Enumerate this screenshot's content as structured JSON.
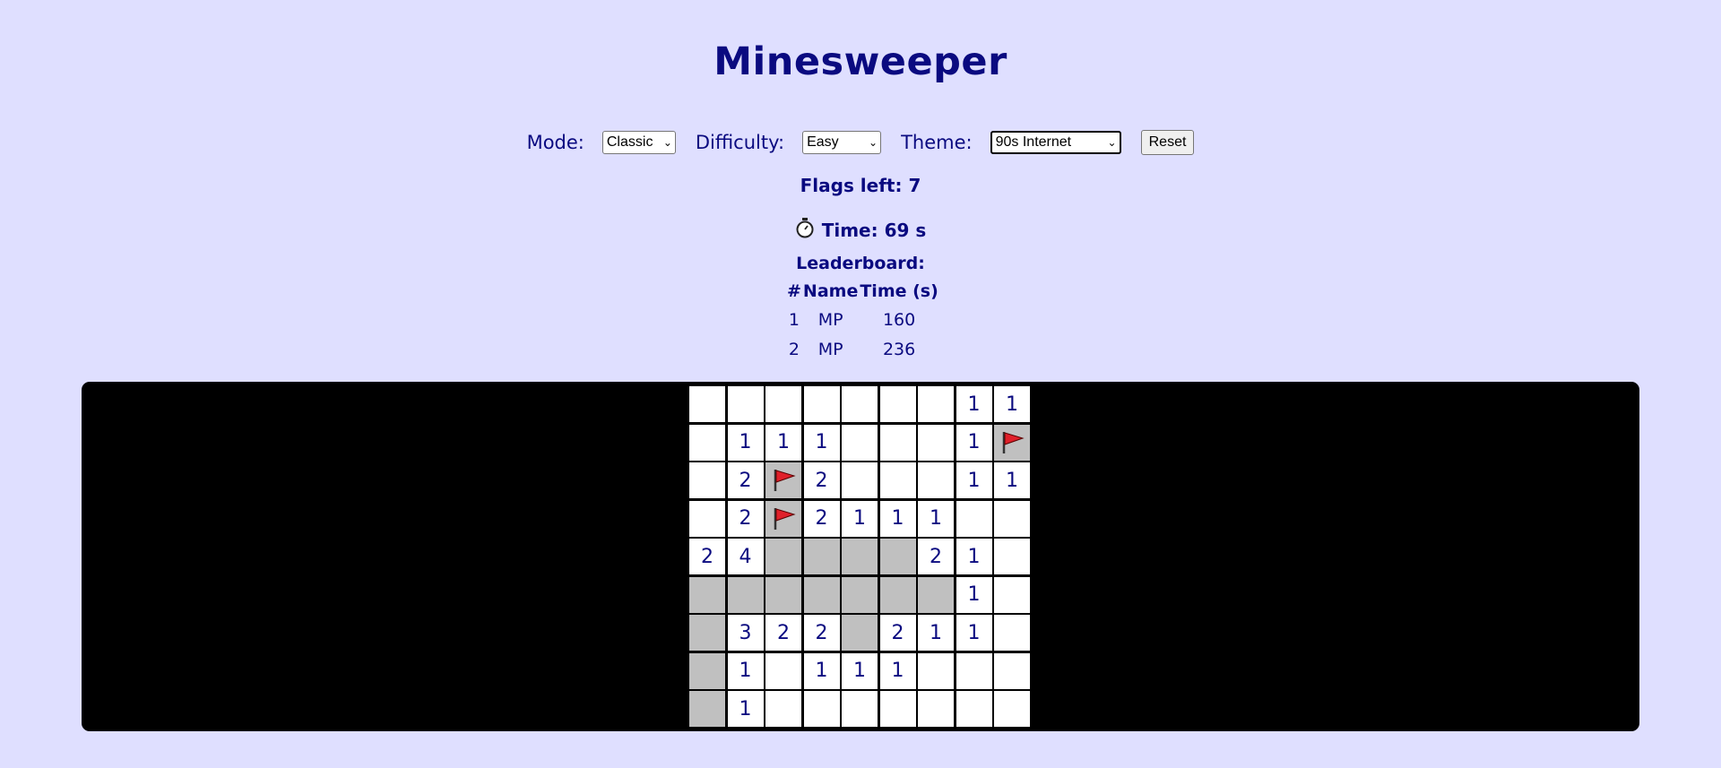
{
  "title": "Minesweeper",
  "controls": {
    "mode_label": "Mode:",
    "mode_value": "Classic",
    "difficulty_label": "Difficulty:",
    "difficulty_value": "Easy",
    "theme_label": "Theme:",
    "theme_value": "90s Internet",
    "reset_label": "Reset"
  },
  "status": {
    "flags_text": "Flags left: 7",
    "time_text": "Time: 69 s"
  },
  "leaderboard": {
    "title": "Leaderboard:",
    "headers": [
      "#",
      "Name",
      "Time (s)"
    ],
    "rows": [
      [
        "1",
        "MP",
        "160"
      ],
      [
        "2",
        "MP",
        "236"
      ]
    ]
  },
  "board": {
    "rows": [
      [
        " ",
        " ",
        " ",
        " ",
        " ",
        " ",
        " ",
        "1",
        "1"
      ],
      [
        " ",
        "1",
        "1",
        "1",
        " ",
        " ",
        " ",
        "1",
        "F"
      ],
      [
        " ",
        "2",
        "F",
        "2",
        " ",
        " ",
        " ",
        "1",
        "1"
      ],
      [
        " ",
        "2",
        "F",
        "2",
        "1",
        "1",
        "1",
        " ",
        " "
      ],
      [
        "2",
        "4",
        "H",
        "H",
        "H",
        "H",
        "2",
        "1",
        " "
      ],
      [
        "H",
        "H",
        "H",
        "H",
        "H",
        "H",
        "H",
        "1",
        " "
      ],
      [
        "H",
        "3",
        "2",
        "2",
        "H",
        "2",
        "1",
        "1",
        " "
      ],
      [
        "H",
        "1",
        " ",
        "1",
        "1",
        "1",
        " ",
        " ",
        " "
      ],
      [
        "H",
        "1",
        " ",
        " ",
        " ",
        " ",
        " ",
        " ",
        " "
      ]
    ],
    "legend": {
      "F": "flag-icon",
      "H": "hidden",
      " ": "revealed-empty"
    }
  },
  "colors": {
    "background": "#dfdfff",
    "text": "#0a0a80",
    "board": "#000000",
    "hidden_cell": "#c0c0c0",
    "flag": "#e0202a"
  }
}
